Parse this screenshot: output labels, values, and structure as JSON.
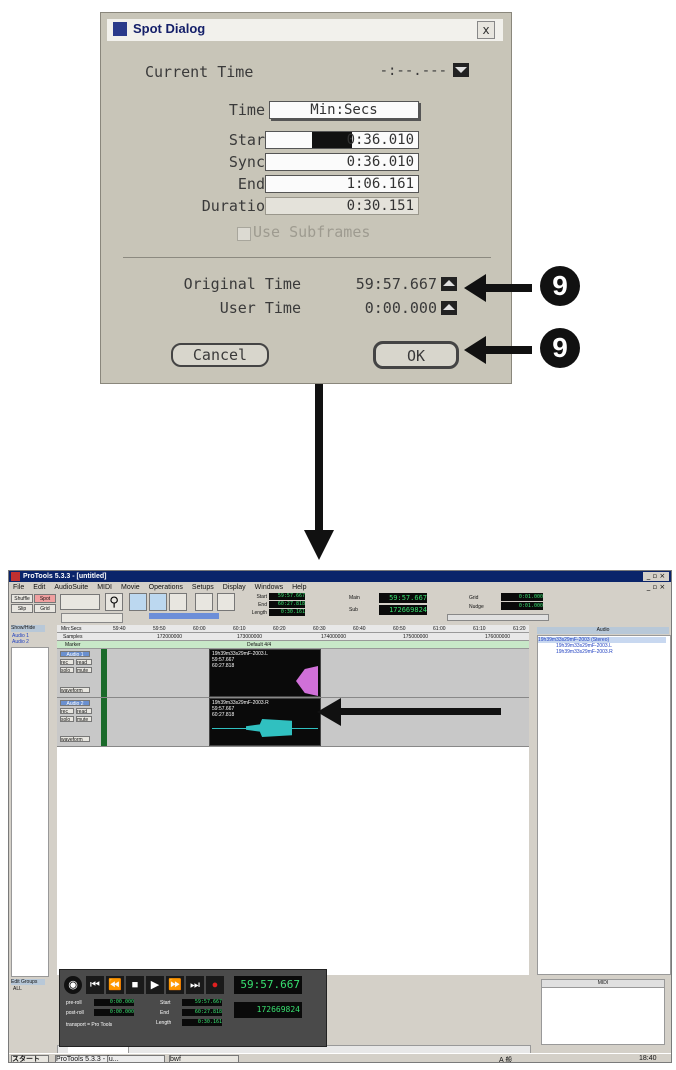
{
  "dialog": {
    "title": "Spot Dialog",
    "close": "x",
    "current_time_label": "Current Time",
    "current_time_value": "-:--.---",
    "time_label": "Time",
    "time_format": "Min:Secs",
    "start_label": "Star",
    "start_value": "0:36.010",
    "sync_label": "Sync",
    "sync_value": "0:36.010",
    "end_label": "End",
    "end_value": "1:06.161",
    "duration_label": "Duratio",
    "duration_value": "0:30.151",
    "subframes_label": "Use Subframes",
    "original_time_label": "Original Time",
    "original_time_value": "59:57.667",
    "user_time_label": "User Time",
    "user_time_value": "0:00.000",
    "cancel_label": "Cancel",
    "ok_label": "OK"
  },
  "annotations": {
    "badge_1": "9",
    "badge_2": "9"
  },
  "protools": {
    "title": "ProTools 5.3.3 - [untitled]",
    "menu": [
      "File",
      "Edit",
      "AudioSuite",
      "MIDI",
      "Movie",
      "Operations",
      "Setups",
      "Display",
      "Windows",
      "Help"
    ],
    "modes": [
      "Shuffle",
      "Spot",
      "Slip",
      "Grid"
    ],
    "counter_labels": {
      "start": "Start",
      "end": "End",
      "length": "Length",
      "main": "Main",
      "sub": "Sub",
      "grid": "Grid",
      "nudge": "Nudge"
    },
    "counters": {
      "start": "59:57.667",
      "end": "60:27.818",
      "length": "0:30.161",
      "main": "59:57.667",
      "sub": "172669824",
      "grid": "0:01.000",
      "nudge": "0:01.000"
    },
    "ruler": {
      "show_hide": "Show/Hide",
      "min_secs": "Min:Secs",
      "samples": "Samples",
      "marker": "Marker",
      "time_ticks": [
        "59:40",
        "59:50",
        "60:00",
        "60:10",
        "60:20",
        "60:30",
        "60:40",
        "60:50",
        "61:00",
        "61:10",
        "61:20"
      ],
      "sample_ticks": [
        "172000000",
        "173000000",
        "174000000",
        "175000000",
        "176000000"
      ],
      "marker_text": "Default 4/4"
    },
    "tracks": [
      {
        "name": "Audio 1",
        "rec": "rec",
        "read": "read",
        "solo": "solo",
        "mute": "mute",
        "view": "waveform",
        "clip_name": "19h39m33s29mF-2003.L",
        "clip_time1": "59:57.667",
        "clip_time2": "60:27.818"
      },
      {
        "name": "Audio 2",
        "rec": "rec",
        "read": "read",
        "solo": "solo",
        "mute": "mute",
        "view": "waveform",
        "clip_name": "19h39m33s29mF-2003.R",
        "clip_time1": "59:57.667",
        "clip_time2": "60:27.818"
      }
    ],
    "show_hide_list": [
      "Audio 1",
      "Audio 2"
    ],
    "edit_groups_label": "Edit Groups",
    "edit_groups_item": "ALL",
    "regions_header": "Audio",
    "regions": [
      "19h39m33s29mF-2003 (Stereo)",
      "19h39m33s29mF-2003.L",
      "19h39m33s29mF-2003.R"
    ],
    "midi_header": "MIDI",
    "transport": {
      "preroll_label": "pre-roll",
      "postroll_label": "post-roll",
      "preroll": "0:00.000",
      "postroll": "0:00.000",
      "start_label": "Start",
      "end_label": "End",
      "length_label": "Length",
      "start": "59:57.667",
      "end": "60:27.818",
      "length": "0:30.161",
      "main": "59:57.667",
      "sub": "172669824",
      "transport_label": "transport = Pro Tools"
    },
    "taskbar": {
      "start_label": "スタート",
      "task1": "ProTools 5.3.3 - [u...",
      "task2": "bwf",
      "tray": "A 般",
      "clock": "18:40"
    }
  },
  "colors": {
    "lcd_green": "#38e070",
    "waveform": "#d070d8",
    "waveform_r": "#30c0c0",
    "title_blue": "#0a246a"
  }
}
